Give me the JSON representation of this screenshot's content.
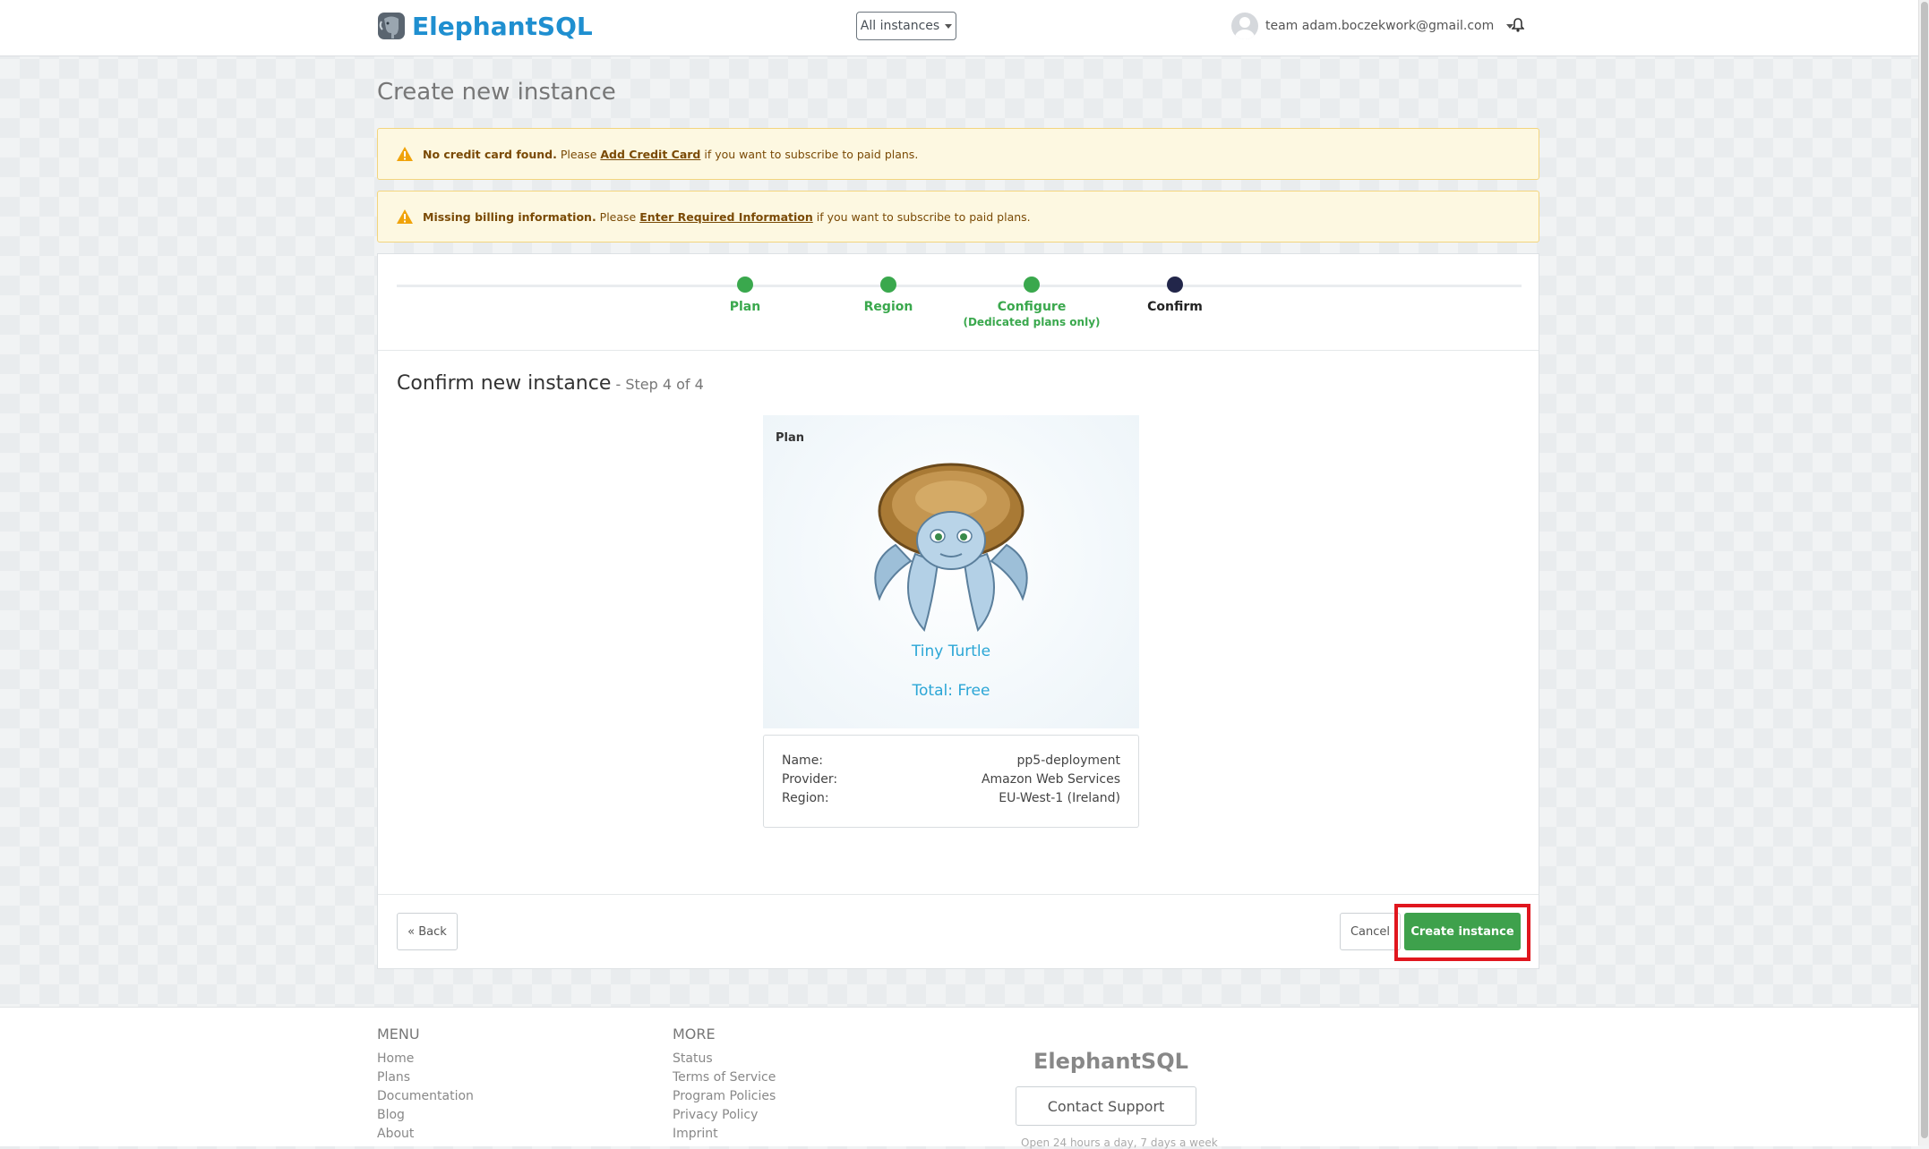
{
  "header": {
    "brand": "ElephantSQL",
    "instances_label": "All instances",
    "user_label": "team adam.boczekwork@gmail.com"
  },
  "page": {
    "title": "Create new instance"
  },
  "alerts": [
    {
      "bold": "No credit card found.",
      "pre": " Please ",
      "link": "Add Credit Card",
      "post": " if you want to subscribe to paid plans."
    },
    {
      "bold": "Missing billing information.",
      "pre": " Please ",
      "link": "Enter Required Information",
      "post": " if you want to subscribe to paid plans."
    }
  ],
  "steps": [
    {
      "label": "Plan",
      "sub": "",
      "state": "done"
    },
    {
      "label": "Region",
      "sub": "",
      "state": "done"
    },
    {
      "label": "Configure",
      "sub": "(Dedicated plans only)",
      "state": "done"
    },
    {
      "label": "Confirm",
      "sub": "",
      "state": "current"
    }
  ],
  "confirm": {
    "title": "Confirm new instance",
    "step_text": " - Step 4 of 4",
    "plan_label": "Plan",
    "plan_name": "Tiny Turtle",
    "total": "Total: Free",
    "details": [
      {
        "key": "Name:",
        "value": "pp5-deployment"
      },
      {
        "key": "Provider:",
        "value": "Amazon Web Services"
      },
      {
        "key": "Region:",
        "value": "EU-West-1 (Ireland)"
      }
    ],
    "back_label": "« Back",
    "cancel_label": "Cancel",
    "create_label": "Create instance"
  },
  "footer": {
    "menu_heading": "MENU",
    "menu_items": [
      "Home",
      "Plans",
      "Documentation",
      "Blog",
      "About"
    ],
    "more_heading": "MORE",
    "more_items": [
      "Status",
      "Terms of Service",
      "Program Policies",
      "Privacy Policy",
      "Imprint"
    ],
    "brand": "ElephantSQL",
    "contact_label": "Contact Support",
    "hours_text": "Open 24 hours a day, 7 days a week"
  },
  "colors": {
    "brand": "#1f8fd0",
    "done_step": "#3aa84d",
    "current_step": "#22264a",
    "create_button": "#3ea14c",
    "highlight": "#e0161e"
  },
  "icons": [
    "elephant-logo-icon",
    "warning-icon",
    "bell-icon",
    "turtle-image"
  ]
}
